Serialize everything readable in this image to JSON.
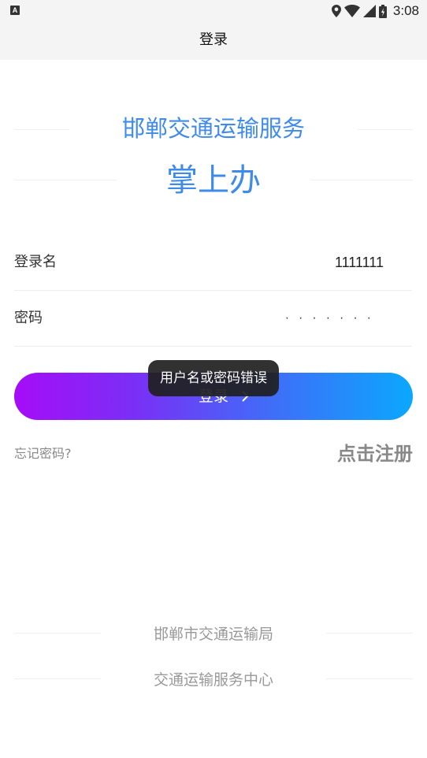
{
  "status_bar": {
    "left_icon_letter": "A",
    "time": "3:08",
    "icons": [
      "location-icon",
      "wifi-icon",
      "signal-icon",
      "battery-icon"
    ]
  },
  "app_bar": {
    "title": "登录"
  },
  "brand": {
    "title": "邯郸交通运输服务",
    "subtitle": "掌上办",
    "color": "#3f8bea"
  },
  "form": {
    "username_label": "登录名",
    "username_value": "1111111",
    "password_label": "密码",
    "password_value": "·······"
  },
  "login_button": {
    "label": "登录",
    "gradient_start": "#a60cf8",
    "gradient_end": "#0aa8fd"
  },
  "links": {
    "forgot_password": "忘记密码?",
    "register": "点击注册"
  },
  "toast": {
    "message": "用户名或密码错误"
  },
  "footer": {
    "line1": "邯郸市交通运输局",
    "line2": "交通运输服务中心"
  }
}
